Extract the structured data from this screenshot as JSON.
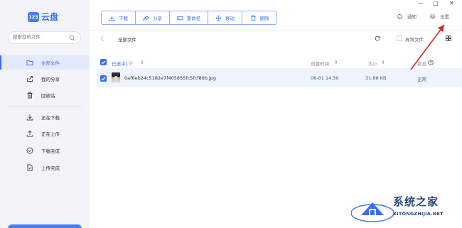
{
  "app": {
    "logo_badge": "123",
    "logo_text": "云盘"
  },
  "search": {
    "placeholder": "搜索您的文件"
  },
  "sidebar": {
    "items": [
      {
        "label": "全部文件",
        "icon": "folder-icon",
        "active": true
      },
      {
        "label": "我的分享",
        "icon": "share-icon"
      },
      {
        "label": "回收站",
        "icon": "trash-icon"
      },
      {
        "label": "正在下载",
        "icon": "download-icon"
      },
      {
        "label": "正在上传",
        "icon": "upload-icon"
      },
      {
        "label": "下载完成",
        "icon": "check-circle-icon"
      },
      {
        "label": "上传完成",
        "icon": "file-check-icon"
      }
    ]
  },
  "toolbar": {
    "download": "下载",
    "share": "分享",
    "rename": "重命名",
    "move": "移动",
    "delete": "删除"
  },
  "header": {
    "notify": "通知",
    "settings": "设置"
  },
  "window": {
    "minimize": "—",
    "maximize": "□",
    "close": "✕"
  },
  "breadcrumb": {
    "current": "全部文件"
  },
  "filter": {
    "abnormal_files": "异常文件"
  },
  "table": {
    "header_selected": "已选中1个",
    "col_created": "创建时间",
    "col_size": "大小",
    "col_status": "状态",
    "rows": [
      {
        "name": "0af6eb24c5182e7f405855fc5fcf80b.jpg",
        "created": "06-01 14:30",
        "size": "31.88 KB",
        "status": "正常"
      }
    ]
  },
  "watermark": {
    "title": "系统之家",
    "url": "XITONGZHIJIA.NET"
  },
  "colors": {
    "accent": "#3b6ef0",
    "sidebar_bg": "#f2f4f9",
    "row_selected": "#eef3fd",
    "arrow": "#d12a2a"
  }
}
